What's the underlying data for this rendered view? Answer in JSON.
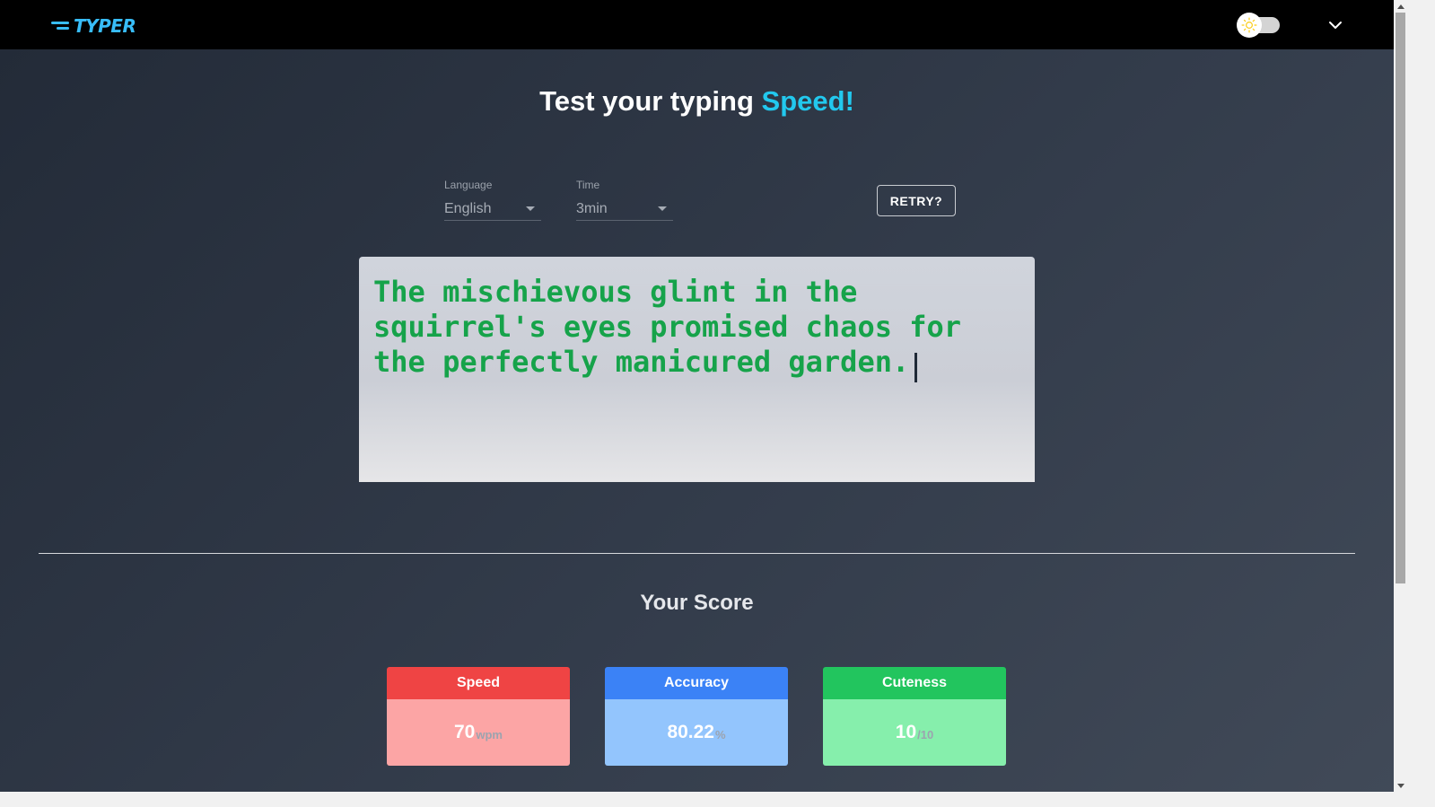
{
  "app": {
    "logo_text": "TYPER",
    "brand_color": "#38bdf8"
  },
  "header": {
    "theme_toggle_icon": "sun-icon",
    "menu_icon": "chevron-down-icon"
  },
  "headline": {
    "text": "Test your typing",
    "accent": "Speed!",
    "accent_color": "#22c8ee"
  },
  "controls": {
    "language": {
      "label": "Language",
      "value": "English"
    },
    "time": {
      "label": "Time",
      "value": "3min"
    },
    "retry_label": "RETRY?"
  },
  "typing": {
    "text": "The mischievous glint in the squirrel's eyes promised chaos for the perfectly manicured garden.",
    "text_color": "#16a34a"
  },
  "score": {
    "title": "Your Score",
    "cards": [
      {
        "label": "Speed",
        "value": "70",
        "unit": "wpm",
        "head_color": "#ef4444",
        "body_color": "#fca5a5"
      },
      {
        "label": "Accuracy",
        "value": "80.22",
        "unit": "%",
        "head_color": "#3b82f6",
        "body_color": "#93c5fd"
      },
      {
        "label": "Cuteness",
        "value": "10",
        "unit": "/10",
        "head_color": "#22c55e",
        "body_color": "#86efac"
      }
    ]
  }
}
